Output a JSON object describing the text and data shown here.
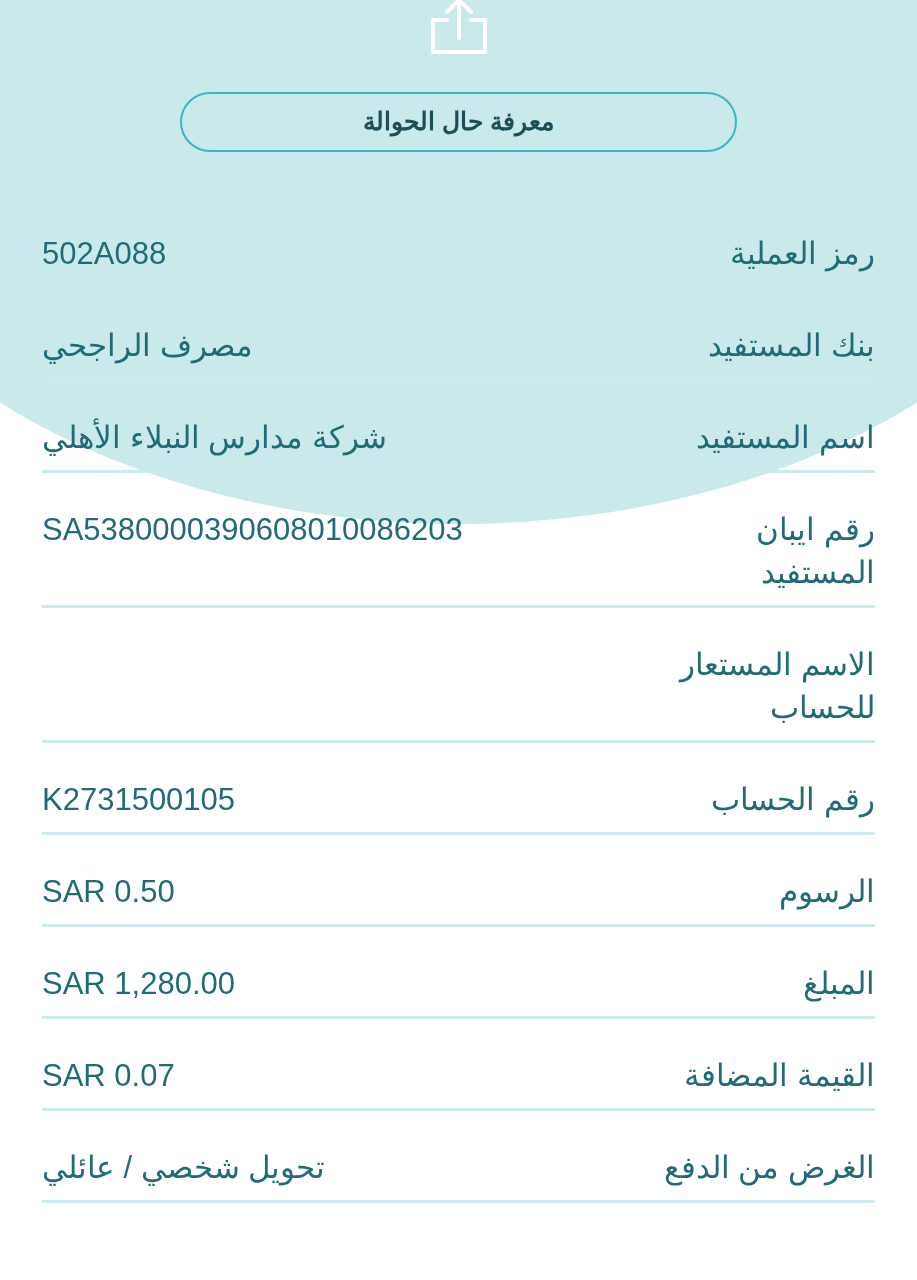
{
  "status_button": {
    "label": "معرفة حال الحوالة"
  },
  "details": [
    {
      "label": "رمز العملية",
      "value": "502A088"
    },
    {
      "label": "بنك المستفيد",
      "value": "مصرف الراجحي"
    },
    {
      "label": "اسم المستفيد",
      "value": "شركة مدارس النبلاء الأهلي"
    },
    {
      "label": "رقم ايبان المستفيد",
      "value": "SA5380000390608010086203"
    },
    {
      "label": "الاسم المستعار للحساب"
    },
    {
      "label": "رقم الحساب",
      "value": "K2731500105"
    },
    {
      "label": "الرسوم",
      "value": "SAR 0.50"
    },
    {
      "label": "المبلغ",
      "value": "SAR 1,280.00"
    },
    {
      "label": "القيمة المضافة",
      "value": "SAR 0.07"
    },
    {
      "label": "الغرض من الدفع",
      "value": "تحويل شخصي / عائلي"
    }
  ]
}
